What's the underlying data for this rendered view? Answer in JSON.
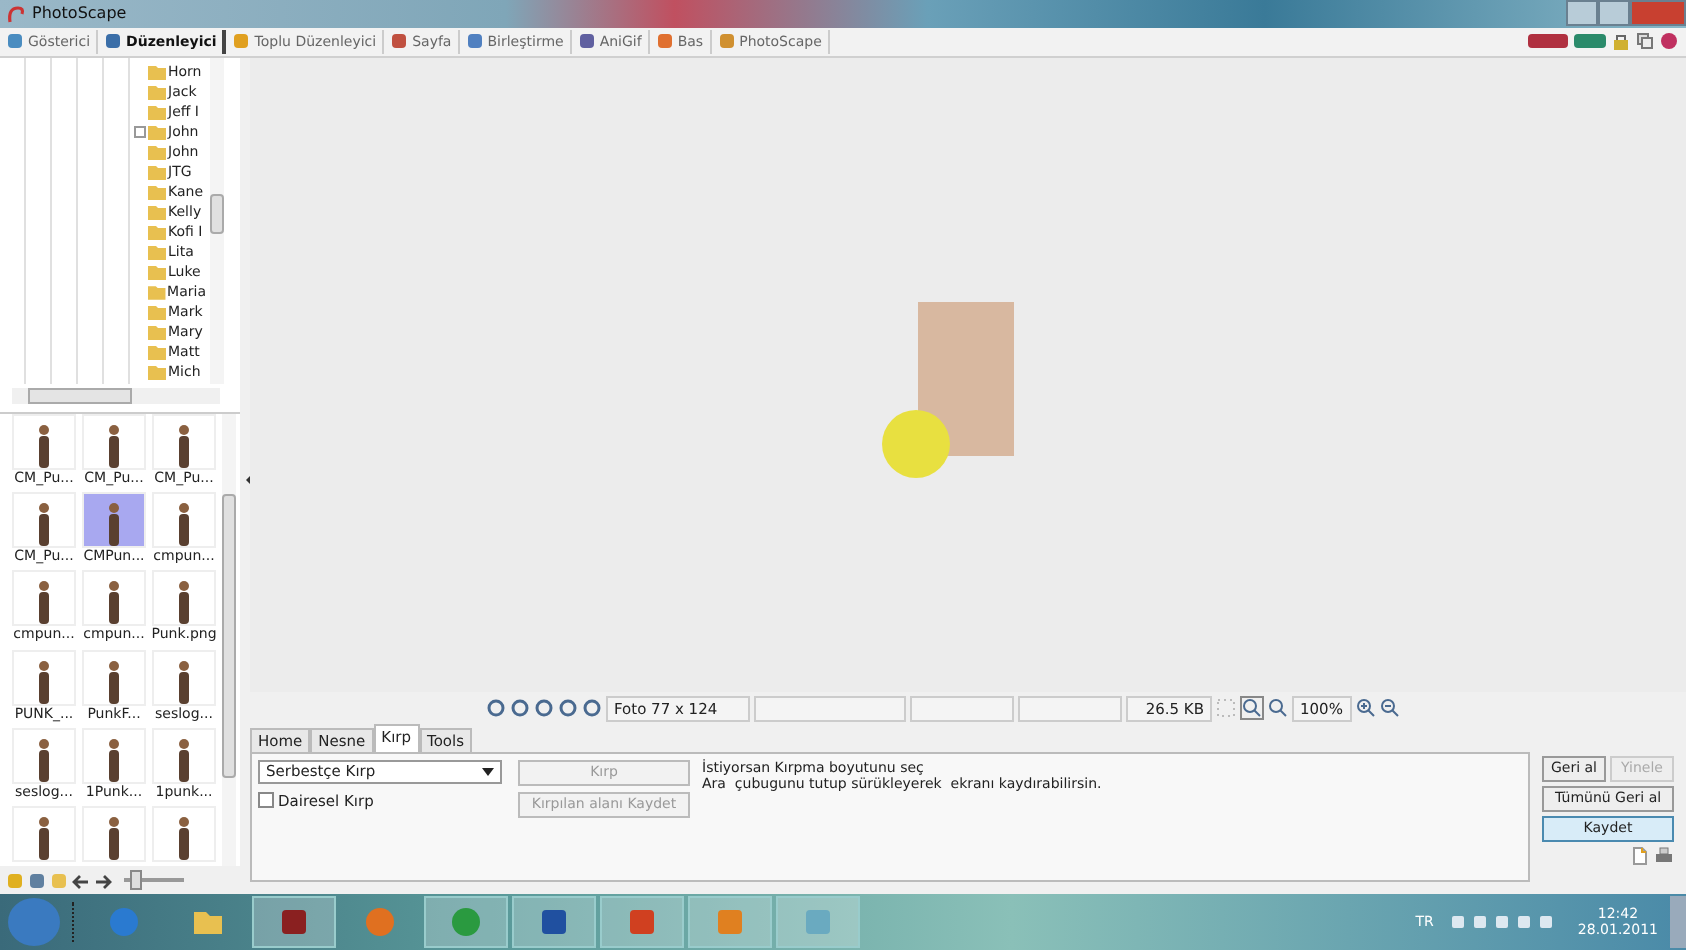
{
  "window": {
    "title": "PhotoScape"
  },
  "tabs": [
    {
      "label": "Gösterici",
      "selected": false
    },
    {
      "label": "Düzenleyici",
      "selected": true
    },
    {
      "label": "Toplu Düzenleyici",
      "selected": false
    },
    {
      "label": "Sayfa",
      "selected": false
    },
    {
      "label": "Birleştirme",
      "selected": false
    },
    {
      "label": "AniGif",
      "selected": false
    },
    {
      "label": "Bas",
      "selected": false
    },
    {
      "label": "PhotoScape",
      "selected": false
    }
  ],
  "folder_tree": {
    "items": [
      {
        "label": "Horn",
        "collapsed": false
      },
      {
        "label": "Jack",
        "collapsed": false
      },
      {
        "label": "Jeff I",
        "collapsed": false
      },
      {
        "label": "John",
        "collapsed": true
      },
      {
        "label": "John",
        "collapsed": false
      },
      {
        "label": "JTG",
        "collapsed": false
      },
      {
        "label": "Kane",
        "collapsed": false
      },
      {
        "label": "Kelly",
        "collapsed": false
      },
      {
        "label": "Kofi I",
        "collapsed": false
      },
      {
        "label": "Lita",
        "collapsed": false
      },
      {
        "label": "Luke",
        "collapsed": false
      },
      {
        "label": "Maria",
        "collapsed": false
      },
      {
        "label": "Mark",
        "collapsed": false
      },
      {
        "label": "Mary",
        "collapsed": false
      },
      {
        "label": "Matt",
        "collapsed": false
      },
      {
        "label": "Mich",
        "collapsed": false
      }
    ]
  },
  "thumbnails": [
    {
      "label": "CM_Pu...",
      "selected": false
    },
    {
      "label": "CM_Pu...",
      "selected": false
    },
    {
      "label": "CM_Pu...",
      "selected": false
    },
    {
      "label": "CM_Pu...",
      "selected": false
    },
    {
      "label": "CMPun...",
      "selected": true
    },
    {
      "label": "cmpun...",
      "selected": false
    },
    {
      "label": "cmpun...",
      "selected": false
    },
    {
      "label": "cmpun...",
      "selected": false
    },
    {
      "label": "Punk.png",
      "selected": false
    },
    {
      "label": "PUNK_...",
      "selected": false
    },
    {
      "label": "PunkF...",
      "selected": false
    },
    {
      "label": "seslog...",
      "selected": false
    },
    {
      "label": "seslog...",
      "selected": false
    },
    {
      "label": "1Punk...",
      "selected": false
    },
    {
      "label": "1punk...",
      "selected": false
    },
    {
      "selected": false
    },
    {
      "selected": false
    },
    {
      "selected": false
    }
  ],
  "thumbnail_size": {
    "level": 0.1
  },
  "status": {
    "dimensions": "Foto 77 x 124",
    "file_size": "26.5 KB",
    "zoom": "100%"
  },
  "edit_tabs": [
    {
      "label": "Home",
      "selected": false
    },
    {
      "label": "Nesne",
      "selected": false
    },
    {
      "label": "Kırp",
      "selected": true
    },
    {
      "label": "Tools",
      "selected": false
    }
  ],
  "crop": {
    "mode": "Serbestçe Kırp",
    "circular": {
      "label": "Dairesel Kırp",
      "checked": false
    },
    "buttons": [
      {
        "label": "Kırp",
        "disabled": true
      },
      {
        "label": "Kırpılan alanı Kaydet",
        "disabled": true
      }
    ],
    "hint_lines": [
      "İstiyorsan Kırpma boyutunu seç",
      "Ara  çubugunu tutup sürükleyerek  ekranı kaydırabilirsin."
    ]
  },
  "actions": [
    {
      "label": "Geri al",
      "disabled": false,
      "focused": false
    },
    {
      "label": "Yinele",
      "disabled": true,
      "focused": false
    },
    {
      "label": "Tümünü Geri al",
      "disabled": false,
      "focused": false
    },
    {
      "label": "Kaydet",
      "disabled": false,
      "focused": true
    }
  ],
  "taskbar": {
    "language": "TR",
    "time": "12:42",
    "date": "28.01.2011"
  }
}
